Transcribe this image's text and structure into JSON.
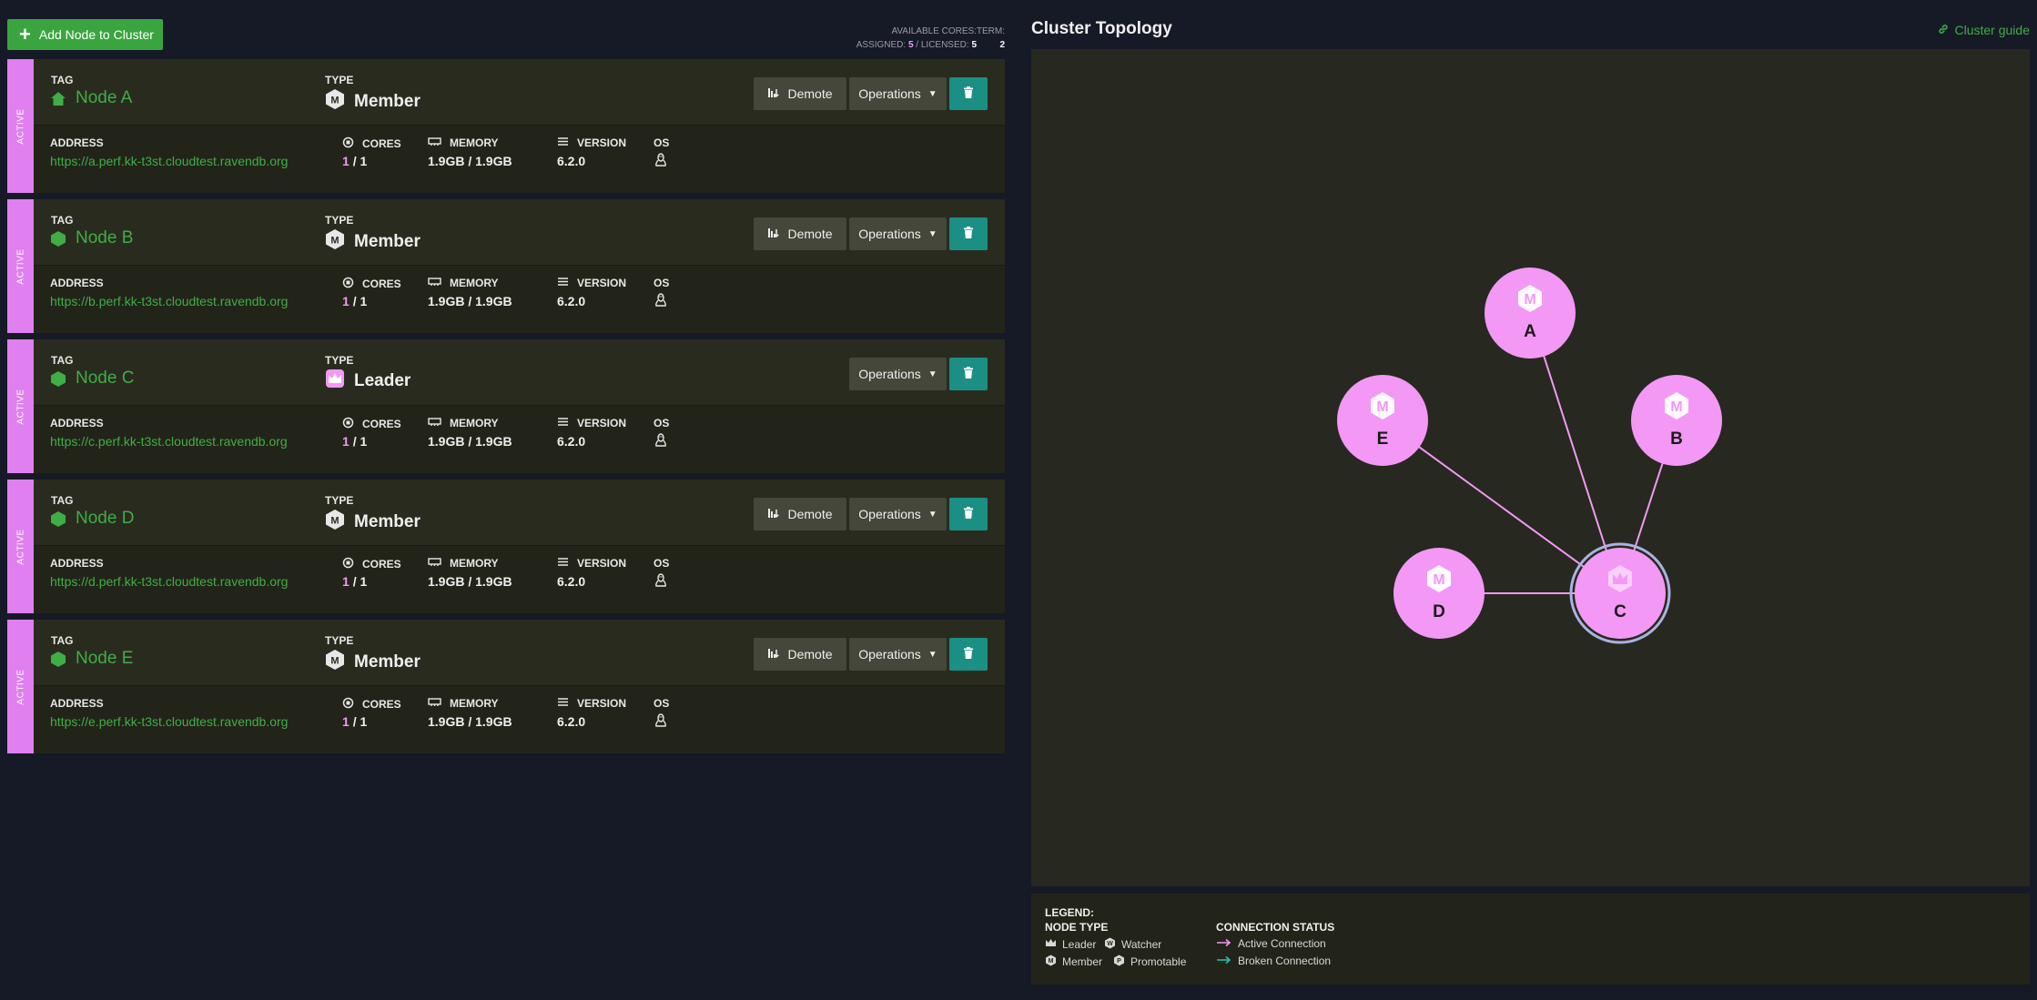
{
  "toolbar": {
    "add_node_label": "Add Node to Cluster"
  },
  "licensing": {
    "available_cores_label": "AVAILABLE CORES:",
    "assigned_label": "ASSIGNED:",
    "assigned_value": "5",
    "licensed_label": "/ LICENSED:",
    "licensed_value": "5",
    "term_label": "TERM:",
    "term_value": "2"
  },
  "labels": {
    "status": "ACTIVE",
    "tag": "TAG",
    "type": "TYPE",
    "address": "ADDRESS",
    "cores": "CORES",
    "memory": "MEMORY",
    "version": "VERSION",
    "os": "OS",
    "demote": "Demote",
    "operations": "Operations"
  },
  "nodes": [
    {
      "name": "Node A",
      "type": "Member",
      "address": "https://a.perf.kk-t3st.cloudtest.ravendb.org",
      "cores_used": "1",
      "cores_total": "/ 1",
      "memory": "1.9GB / 1.9GB",
      "version": "6.2.0",
      "os_icon": "linux-icon",
      "tag_icon": "home-icon"
    },
    {
      "name": "Node B",
      "type": "Member",
      "address": "https://b.perf.kk-t3st.cloudtest.ravendb.org",
      "cores_used": "1",
      "cores_total": "/ 1",
      "memory": "1.9GB / 1.9GB",
      "version": "6.2.0",
      "os_icon": "linux-icon",
      "tag_icon": "hexagon-icon"
    },
    {
      "name": "Node C",
      "type": "Leader",
      "address": "https://c.perf.kk-t3st.cloudtest.ravendb.org",
      "cores_used": "1",
      "cores_total": "/ 1",
      "memory": "1.9GB / 1.9GB",
      "version": "6.2.0",
      "os_icon": "linux-icon",
      "tag_icon": "hexagon-icon"
    },
    {
      "name": "Node D",
      "type": "Member",
      "address": "https://d.perf.kk-t3st.cloudtest.ravendb.org",
      "cores_used": "1",
      "cores_total": "/ 1",
      "memory": "1.9GB / 1.9GB",
      "version": "6.2.0",
      "os_icon": "linux-icon",
      "tag_icon": "hexagon-icon"
    },
    {
      "name": "Node E",
      "type": "Member",
      "address": "https://e.perf.kk-t3st.cloudtest.ravendb.org",
      "cores_used": "1",
      "cores_total": "/ 1",
      "memory": "1.9GB / 1.9GB",
      "version": "6.2.0",
      "os_icon": "linux-icon",
      "tag_icon": "hexagon-icon"
    }
  ],
  "topology": {
    "title": "Cluster Topology",
    "guide_label": "Cluster guide",
    "nodes": [
      {
        "label": "A",
        "role": "member"
      },
      {
        "label": "B",
        "role": "member"
      },
      {
        "label": "C",
        "role": "leader"
      },
      {
        "label": "D",
        "role": "member"
      },
      {
        "label": "E",
        "role": "member"
      }
    ],
    "connections": [
      [
        "C",
        "A"
      ],
      [
        "C",
        "B"
      ],
      [
        "C",
        "D"
      ],
      [
        "C",
        "E"
      ]
    ]
  },
  "legend": {
    "title": "LEGEND:",
    "node_type_title": "NODE TYPE",
    "leader": "Leader",
    "watcher": "Watcher",
    "member": "Member",
    "promotable": "Promotable",
    "connection_title": "CONNECTION STATUS",
    "active": "Active Connection",
    "broken": "Broken Connection"
  },
  "colors": {
    "accent_green": "#3fae45",
    "node_pink": "#f398f5",
    "stripe_pink": "#df7ff0",
    "delete_teal": "#1b8f84",
    "active_connection": "#f398f5",
    "broken_connection": "#1fc4b0"
  }
}
